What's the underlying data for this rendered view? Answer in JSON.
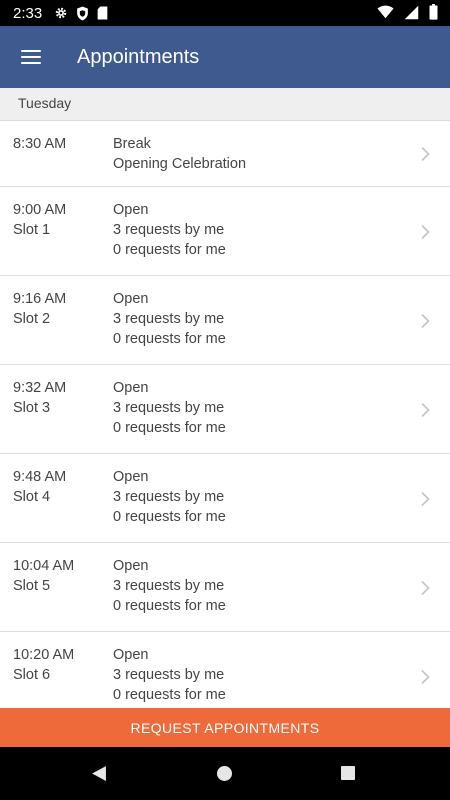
{
  "status_bar": {
    "time": "2:33",
    "icons_left": [
      "settings-icon",
      "shield-icon",
      "sd-card-icon"
    ],
    "icons_right": [
      "wifi-icon",
      "signal-icon",
      "battery-icon"
    ]
  },
  "app_bar": {
    "menu_icon": "menu-icon",
    "title": "Appointments",
    "color": "#3e5a8f"
  },
  "section": {
    "day": "Tuesday"
  },
  "appointments": [
    {
      "time": "8:30 AM",
      "slot": "",
      "status": "Break",
      "line2": "Opening Celebration",
      "line3": ""
    },
    {
      "time": "9:00 AM",
      "slot": "Slot 1",
      "status": "Open",
      "line2": "3 requests by me",
      "line3": "0 requests for me"
    },
    {
      "time": "9:16 AM",
      "slot": "Slot 2",
      "status": "Open",
      "line2": "3 requests by me",
      "line3": "0 requests for me"
    },
    {
      "time": "9:32 AM",
      "slot": "Slot 3",
      "status": "Open",
      "line2": "3 requests by me",
      "line3": "0 requests for me"
    },
    {
      "time": "9:48 AM",
      "slot": "Slot 4",
      "status": "Open",
      "line2": "3 requests by me",
      "line3": "0 requests for me"
    },
    {
      "time": "10:04 AM",
      "slot": "Slot 5",
      "status": "Open",
      "line2": "3 requests by me",
      "line3": "0 requests for me"
    },
    {
      "time": "10:20 AM",
      "slot": "Slot 6",
      "status": "Open",
      "line2": "3 requests by me",
      "line3": "0 requests for me"
    }
  ],
  "cta": {
    "label": "REQUEST APPOINTMENTS",
    "color": "#ee6a3a"
  },
  "nav_bar": {
    "icons": [
      "back-icon",
      "home-icon",
      "recents-icon"
    ]
  }
}
